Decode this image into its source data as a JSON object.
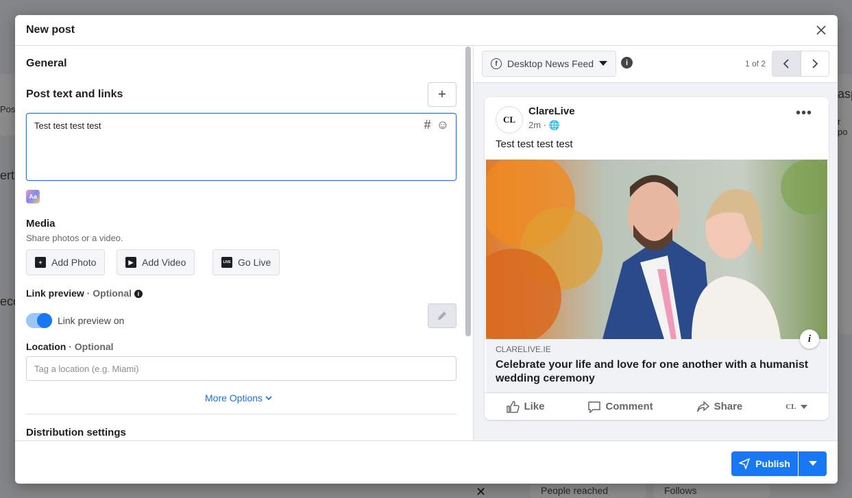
{
  "background": {
    "left_label_1": "Pos",
    "left_label_2": "ert",
    "left_label_3": "eco",
    "right_label_1": "asp",
    "right_label_2": "r po",
    "stat_1": "People reached",
    "stat_2": "Follows"
  },
  "modal": {
    "title": "New post"
  },
  "left": {
    "general": "General",
    "post_text_heading": "Post text and links",
    "post_text_value": "Test test test test",
    "media_heading": "Media",
    "media_sub": "Share photos or a video.",
    "add_photo": "Add Photo",
    "add_video": "Add Video",
    "go_live": "Go Live",
    "live_badge": "LIVE",
    "link_preview_heading": "Link preview",
    "optional": "· Optional",
    "link_preview_toggle": "Link preview on",
    "location_heading": "Location",
    "location_placeholder": "Tag a location (e.g. Miami)",
    "more_options": "More Options",
    "distribution": "Distribution settings"
  },
  "right": {
    "placement": "Desktop News Feed",
    "pager": "1 of 2",
    "page_name": "ClareLive",
    "avatar_text": "CL",
    "post_time": "2m ·",
    "post_text": "Test test test test",
    "link_domain": "CLARELIVE.IE",
    "link_headline": "Celebrate your life and love for one another with a humanist wedding ceremony",
    "like": "Like",
    "comment": "Comment",
    "share": "Share"
  },
  "footer": {
    "publish": "Publish"
  },
  "colors": {
    "accent": "#1877f2",
    "link": "#216fdb"
  }
}
